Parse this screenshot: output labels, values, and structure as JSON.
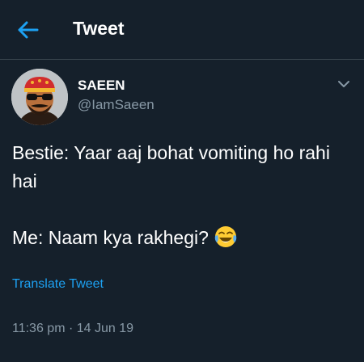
{
  "header": {
    "title": "Tweet",
    "back_icon": "arrow-left-icon"
  },
  "tweet": {
    "display_name": "SAEEN",
    "handle": "@IamSaeen",
    "text_line1": "Bestie: Yaar aaj bohat vomiting ho rahi hai",
    "text_line2": "Me: Naam kya rakhegi?",
    "emoji": "tears-of-joy-icon",
    "translate_label": "Translate Tweet",
    "timestamp": "11:36 pm · 14 Jun 19"
  },
  "colors": {
    "background": "#15202b",
    "accent": "#1da1f2",
    "secondary_text": "#8899a6",
    "divider": "#38444d"
  }
}
